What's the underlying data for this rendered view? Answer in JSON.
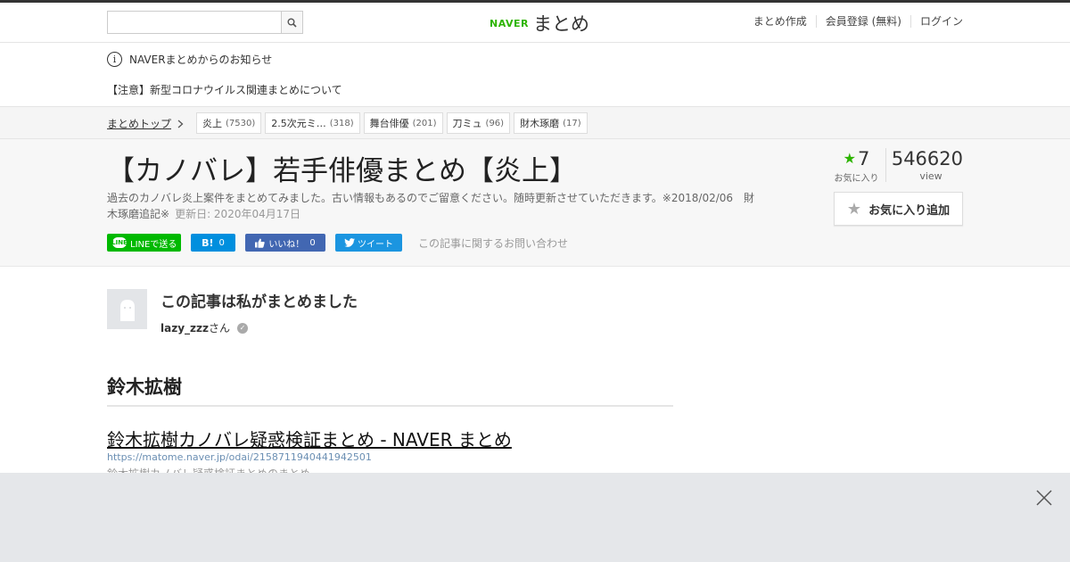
{
  "header": {
    "search_placeholder": "",
    "logo_naver": "NAVER",
    "logo_matome": "まとめ",
    "nav": [
      "まとめ作成",
      "会員登録 (無料)",
      "ログイン"
    ]
  },
  "notice": {
    "heading": "NAVERまとめからのお知らせ",
    "link": "【注意】新型コロナウイルス関連まとめについて"
  },
  "breadcrumb": {
    "top": "まとめトップ",
    "tags": [
      {
        "label": "炎上",
        "count": "(7530)"
      },
      {
        "label": "2.5次元ミ…",
        "count": "(318)"
      },
      {
        "label": "舞台俳優",
        "count": "(201)"
      },
      {
        "label": "刀ミュ",
        "count": "(96)"
      },
      {
        "label": "財木琢磨",
        "count": "(17)"
      }
    ]
  },
  "article": {
    "title": "【カノバレ】若手俳優まとめ【炎上】",
    "description": "過去のカノバレ炎上案件をまとめてみました。古い情報もあるのでご留意ください。随時更新させていただきます。※2018/02/06　財木琢磨追記※",
    "updated": "更新日: 2020年04月17日",
    "share": {
      "line": "LINEで送る",
      "line_badge": "LINE",
      "hatena": "B!",
      "hatena_count": "0",
      "fb": "いいね！",
      "fb_count": "0",
      "tweet": "ツイート"
    },
    "inquiry": "この記事に関するお問い合わせ",
    "fav_count": "7",
    "fav_label": "お気に入り",
    "view_count": "546620",
    "view_label": "view",
    "fav_add": "お気に入り追加"
  },
  "author": {
    "heading": "この記事は私がまとめました",
    "name": "lazy_zzz",
    "suffix": "さん"
  },
  "content": {
    "section_heading": "鈴木拡樹",
    "link_title": "鈴木拡樹カノバレ疑惑検証まとめ - NAVER まとめ",
    "link_url": "https://matome.naver.jp/odai/2158711940441942501",
    "link_desc": "鈴木拡樹カノバレ疑惑検証まとめのまとめ"
  },
  "colors": {
    "naver_green": "#2db400",
    "line_green": "#00b900",
    "hatena_blue": "#008fde",
    "fb_blue": "#4267b2",
    "twitter_blue": "#1b95e0"
  }
}
